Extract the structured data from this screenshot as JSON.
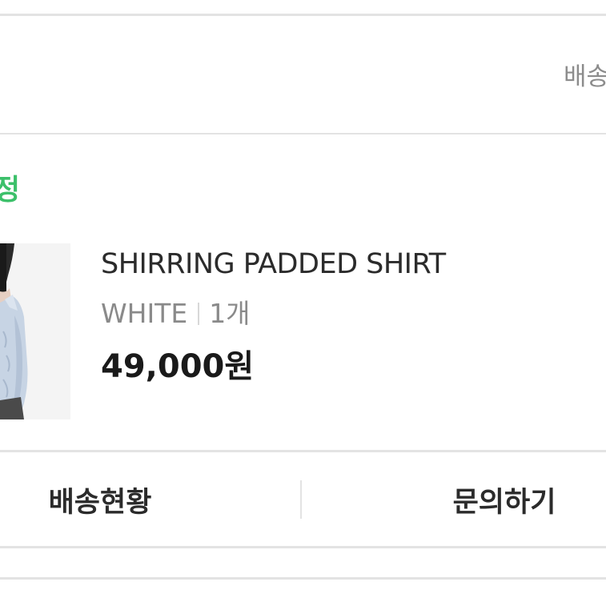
{
  "header": {
    "shipping_label": "배송"
  },
  "order": {
    "status_text": "정"
  },
  "product": {
    "name": "SHIRRING PADDED SHIRT",
    "color": "WHITE",
    "quantity": "1개",
    "price": "49,000원",
    "image_icon": "product-photo"
  },
  "actions": {
    "delivery_status": "배송현황",
    "inquiry": "문의하기"
  },
  "colors": {
    "status_green": "#3cc06a",
    "divider": "#e3e3e3",
    "text_dark": "#2b2b2b",
    "text_gray": "#8a8a8a"
  }
}
